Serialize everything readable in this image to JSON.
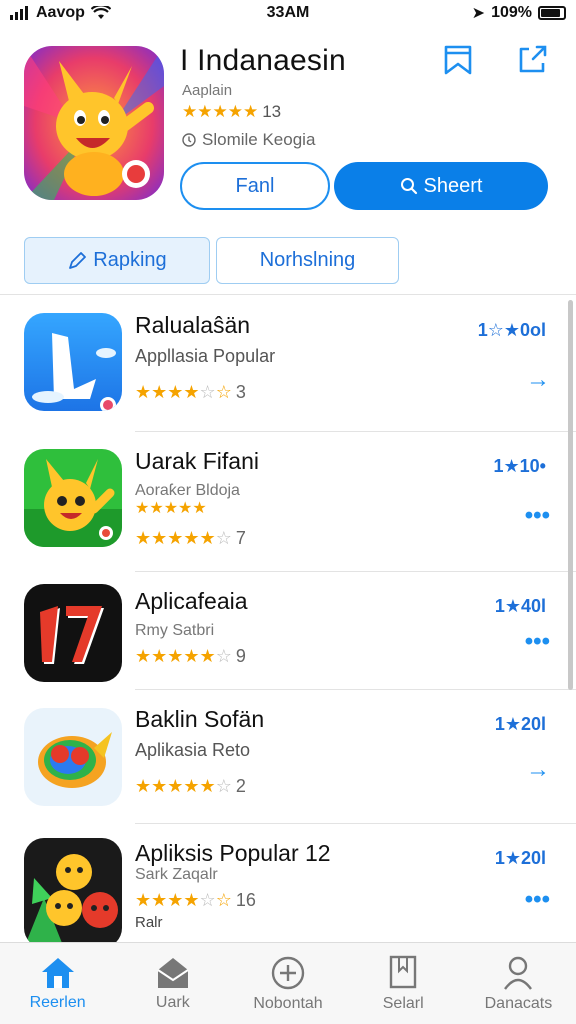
{
  "status": {
    "carrier": "Aavop",
    "time": "33AM",
    "battery": "109%"
  },
  "header": {
    "title": "I Indanaesin",
    "subtitle": "Aaplain",
    "rating_count": "13",
    "developer": "Slomile Keogia",
    "btn_secondary": "Fanl",
    "btn_primary": "Sheert"
  },
  "tabs": [
    {
      "label": "Rapking",
      "active": true
    },
    {
      "label": "Norhslning",
      "active": false
    }
  ],
  "apps": [
    {
      "title": "Ralualaŝän",
      "subtitle": "Appllasia Popular",
      "rating_text": "3",
      "count": "1☆★0ol",
      "action": "arrow",
      "stars": 3.5
    },
    {
      "title": "Uarak Fifani",
      "subtitle": "Aoraƙer Bldoja",
      "rating_text": "7",
      "count": "1★10•",
      "action": "more",
      "stars": 4
    },
    {
      "title": "Aplicafeaia",
      "subtitle": "Rmy Satbri",
      "rating_text": "9",
      "count": "1★40l",
      "action": "more",
      "stars": 4.5
    },
    {
      "title": "Baklin Sofän",
      "subtitle": "Aplikasia Reto",
      "rating_text": "2",
      "count": "1★20l",
      "action": "arrow",
      "stars": 4.5
    },
    {
      "title": "Apliksis Popular 12",
      "subtitle": "Sark Zaqalr",
      "rating_text": "16",
      "extra": "Ralr",
      "count": "1★20l",
      "action": "more",
      "stars": 3.5
    }
  ],
  "tabbar": [
    {
      "label": "Reerlen",
      "icon": "home-icon",
      "active": true
    },
    {
      "label": "Uark",
      "icon": "mail-icon",
      "active": false
    },
    {
      "label": "Nobontah",
      "icon": "plus-circle-icon",
      "active": false
    },
    {
      "label": "Selarl",
      "icon": "book-icon",
      "active": false
    },
    {
      "label": "Danacats",
      "icon": "person-icon",
      "active": false
    }
  ],
  "colors": {
    "accent": "#0a7fe8",
    "star": "#f5a300"
  }
}
